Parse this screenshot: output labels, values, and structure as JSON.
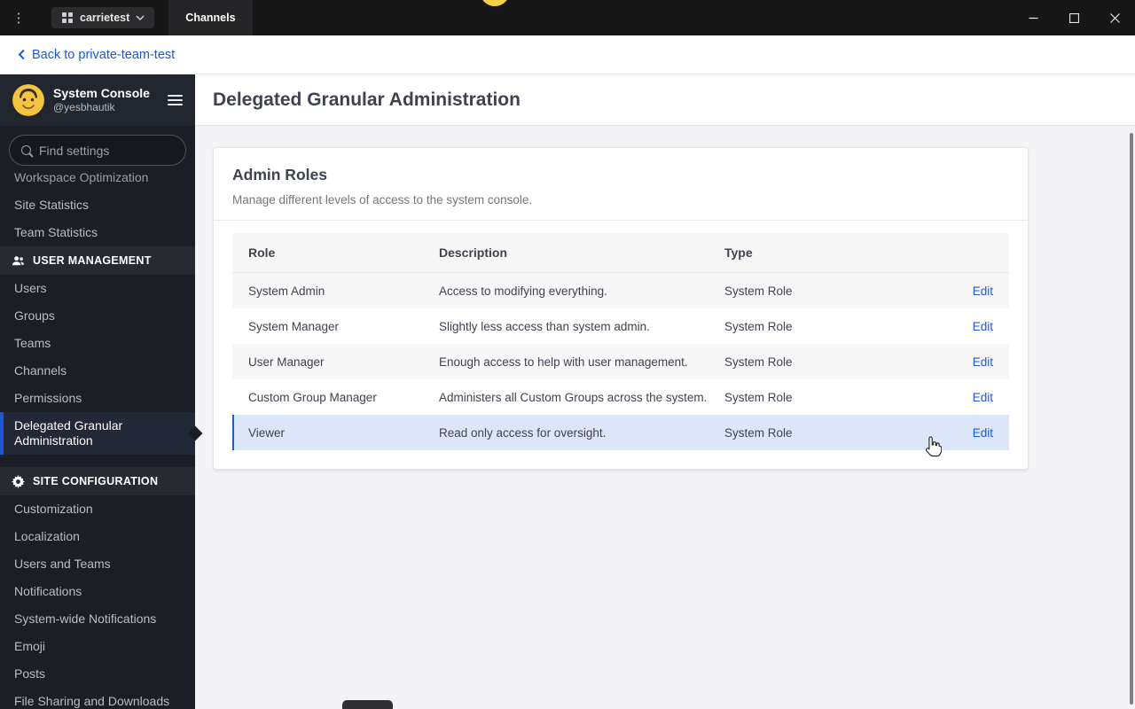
{
  "titlebar": {
    "workspace_label": "carrietest",
    "tab_label": "Channels"
  },
  "backbar": {
    "back_label": "Back to private-team-test"
  },
  "sidebar": {
    "header": {
      "title": "System Console",
      "subtitle": "@yesbhautik"
    },
    "search": {
      "placeholder": "Find settings"
    },
    "partial_item": "Workspace Optimization",
    "top_items": [
      "Site Statistics",
      "Team Statistics"
    ],
    "sections": [
      {
        "label": "USER MANAGEMENT",
        "items": [
          "Users",
          "Groups",
          "Teams",
          "Channels",
          "Permissions",
          "Delegated Granular Administration"
        ]
      },
      {
        "label": "SITE CONFIGURATION",
        "items": [
          "Customization",
          "Localization",
          "Users and Teams",
          "Notifications",
          "System-wide Notifications",
          "Emoji",
          "Posts",
          "File Sharing and Downloads"
        ]
      }
    ],
    "active_item": "Delegated Granular Administration"
  },
  "main": {
    "page_title": "Delegated Granular Administration",
    "card": {
      "title": "Admin Roles",
      "subtitle": "Manage different levels of access to the system console.",
      "table": {
        "columns": [
          "Role",
          "Description",
          "Type"
        ],
        "action_label": "Edit",
        "highlighted_row": "Viewer",
        "rows": [
          {
            "role": "System Admin",
            "description": "Access to modifying everything.",
            "type": "System Role"
          },
          {
            "role": "System Manager",
            "description": "Slightly less access than system admin.",
            "type": "System Role"
          },
          {
            "role": "User Manager",
            "description": "Enough access to help with user management.",
            "type": "System Role"
          },
          {
            "role": "Custom Group Manager",
            "description": "Administers all Custom Groups across the system.",
            "type": "System Role"
          },
          {
            "role": "Viewer",
            "description": "Read only access for oversight.",
            "type": "System Role"
          }
        ]
      }
    }
  },
  "colors": {
    "accent_blue": "#1c58d9",
    "highlight_row": "#dbe7f8",
    "sidebar_bg": "#1b1e24",
    "titlebar_bg": "#171717"
  }
}
